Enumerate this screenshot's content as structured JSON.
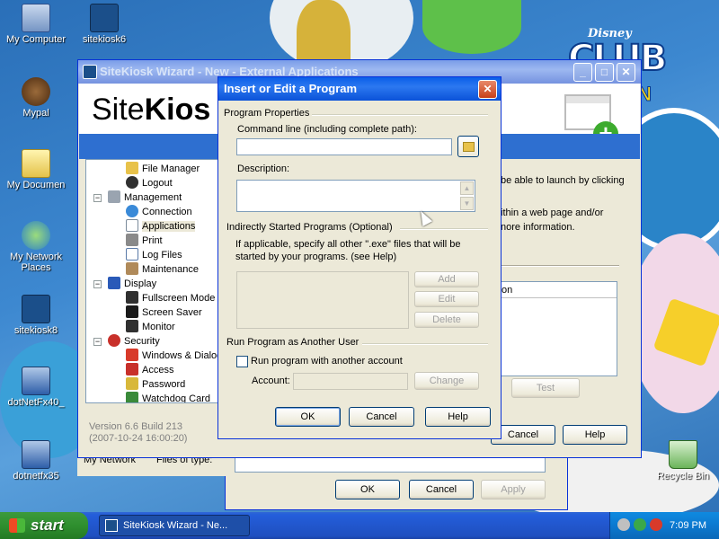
{
  "desktop": {
    "wallpaper_brand": {
      "disney": "Disney",
      "club": "CLUB",
      "penguin": "GUIN"
    },
    "icons": [
      {
        "label": "My Computer",
        "icon": "computer-icon"
      },
      {
        "label": "sitekiosk6",
        "icon": "sitekiosk-icon"
      },
      {
        "label": "Mypal",
        "icon": "mypal-icon"
      },
      {
        "label": "My Documen",
        "icon": "documents-folder-icon"
      },
      {
        "label": "My Network Places",
        "icon": "network-places-icon"
      },
      {
        "label": "sitekiosk8",
        "icon": "sitekiosk-icon"
      },
      {
        "label": "dotNetFx40_",
        "icon": "installer-icon"
      },
      {
        "label": "dotnetfx35",
        "icon": "installer-icon"
      },
      {
        "label": "Recycle Bin",
        "icon": "recycle-bin-icon"
      }
    ]
  },
  "wizard": {
    "title": "SiteKiosk Wizard - New - External Applications",
    "logo_prefix": "Site",
    "logo_suffix": "Kios",
    "tree": [
      {
        "label": "File Manager",
        "icon": "folder-icon"
      },
      {
        "label": "Logout",
        "icon": "user-icon"
      },
      {
        "label": "Management",
        "icon": "gear-icon"
      },
      {
        "label": "Connection",
        "icon": "globe-icon"
      },
      {
        "label": "Applications",
        "icon": "applications-icon"
      },
      {
        "label": "Print",
        "icon": "printer-icon"
      },
      {
        "label": "Log Files",
        "icon": "log-files-icon"
      },
      {
        "label": "Maintenance",
        "icon": "wrench-icon"
      },
      {
        "label": "Display",
        "icon": "monitor-icon"
      },
      {
        "label": "Fullscreen Mode",
        "icon": "fullscreen-icon"
      },
      {
        "label": "Screen Saver",
        "icon": "screensaver-icon"
      },
      {
        "label": "Monitor",
        "icon": "monitor-icon"
      },
      {
        "label": "Security",
        "icon": "shield-icon"
      },
      {
        "label": "Windows & Dialog",
        "icon": "windows-icon"
      },
      {
        "label": "Access",
        "icon": "access-icon"
      },
      {
        "label": "Password",
        "icon": "key-icon"
      },
      {
        "label": "Watchdog Card",
        "icon": "card-icon"
      }
    ],
    "right_text": [
      "be able to launch by clicking",
      "ithin a web page and/or",
      "nore information."
    ],
    "list_header": "on",
    "test_button": "Test",
    "version": "Version 6.6 Build 213",
    "build_date": "(2007-10-24 16:00:20)",
    "cancel_button": "Cancel",
    "help_button": "Help"
  },
  "behind_window": {
    "my_network": "My Network",
    "files_of_type": "Files of type:",
    "ok_button": "OK",
    "cancel_button": "Cancel",
    "apply_button": "Apply"
  },
  "dialog": {
    "title": "Insert or Edit a Program",
    "program_properties": "Program Properties",
    "command_line_label": "Command line (including complete path):",
    "command_line_value": "",
    "description_label": "Description:",
    "description_value": "",
    "indirect_title": "Indirectly Started Programs (Optional)",
    "indirect_desc_1": "If applicable, specify all other \".exe\" files that will be",
    "indirect_desc_2": "started by your programs. (see Help)",
    "add_button": "Add",
    "edit_button": "Edit",
    "delete_button": "Delete",
    "run_as_title": "Run Program as Another User",
    "run_as_checkbox": "Run program with another account",
    "run_as_checked": false,
    "account_label": "Account:",
    "account_value": "",
    "change_button": "Change",
    "ok_button": "OK",
    "cancel_button": "Cancel",
    "help_button": "Help"
  },
  "taskbar": {
    "start_label": "start",
    "task_label": "SiteKiosk Wizard - Ne...",
    "clock": "7:09 PM"
  }
}
